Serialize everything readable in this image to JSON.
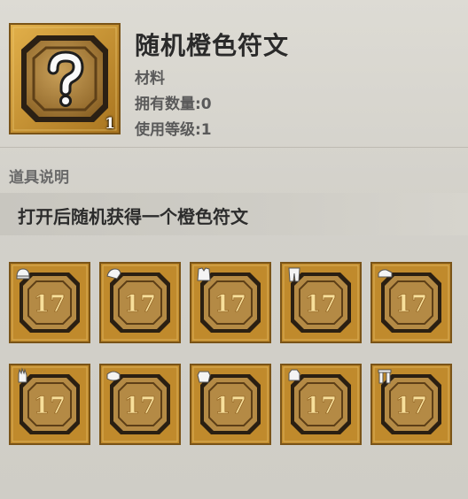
{
  "item": {
    "name": "随机橙色符文",
    "category": "材料",
    "owned": "拥有数量:0",
    "level": "使用等级:1",
    "count": "1",
    "icon": "question-mark-icon"
  },
  "description": {
    "section_label": "道具说明",
    "text": "打开后随机获得一个橙色符文"
  },
  "runes": [
    {
      "slot": "helmet-icon",
      "glyph": "17"
    },
    {
      "slot": "shoulder-icon",
      "glyph": "17"
    },
    {
      "slot": "chest-icon",
      "glyph": "17"
    },
    {
      "slot": "pants-icon",
      "glyph": "17"
    },
    {
      "slot": "boots-icon",
      "glyph": "17"
    },
    {
      "slot": "glove-icon",
      "glyph": "17"
    },
    {
      "slot": "bracer-icon",
      "glyph": "17"
    },
    {
      "slot": "belt-icon",
      "glyph": "17"
    },
    {
      "slot": "gauntlet-icon",
      "glyph": "17"
    },
    {
      "slot": "legguard-icon",
      "glyph": "17"
    }
  ],
  "colors": {
    "frame_gold": "#c9962f",
    "frame_dark": "#3a2a14",
    "rune_glow": "#f2d27a"
  }
}
